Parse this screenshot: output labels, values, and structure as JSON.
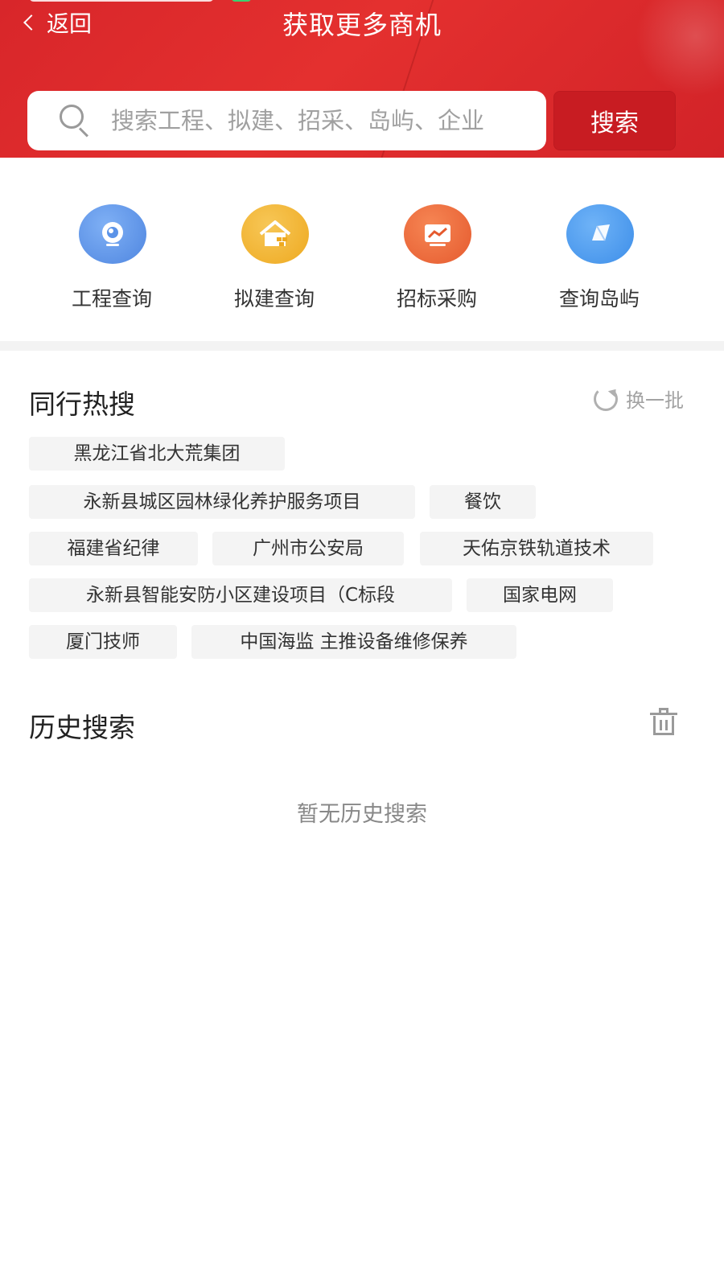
{
  "header": {
    "back_label": "返回",
    "title": "获取更多商机",
    "search": {
      "placeholder": "搜索工程、拟建、招采、岛屿、企业",
      "button_label": "搜索"
    },
    "colors": {
      "primary": "#e12d2f",
      "button": "#c81c22"
    }
  },
  "quick_links": [
    {
      "label": "工程查询",
      "icon": "camera-icon",
      "color": "#5b93e8"
    },
    {
      "label": "拟建查询",
      "icon": "house-icon",
      "color": "#f2b331"
    },
    {
      "label": "招标采购",
      "icon": "trend-chart-icon",
      "color": "#ee6a3a"
    },
    {
      "label": "查询岛屿",
      "icon": "island-icon",
      "color": "#4a9af0"
    }
  ],
  "hot_search": {
    "title": "同行热搜",
    "refresh_label": "换一批",
    "tags": [
      "黑龙江省北大荒集团",
      "永新县城区园林绿化养护服务项目",
      "餐饮",
      "福建省纪律",
      "广州市公安局",
      "天佑京铁轨道技术",
      "永新县智能安防小区建设项目（C标段",
      "国家电网",
      "厦门技师",
      "中国海监 主推设备维修保养"
    ]
  },
  "history": {
    "title": "历史搜索",
    "empty_text": "暂无历史搜索"
  }
}
